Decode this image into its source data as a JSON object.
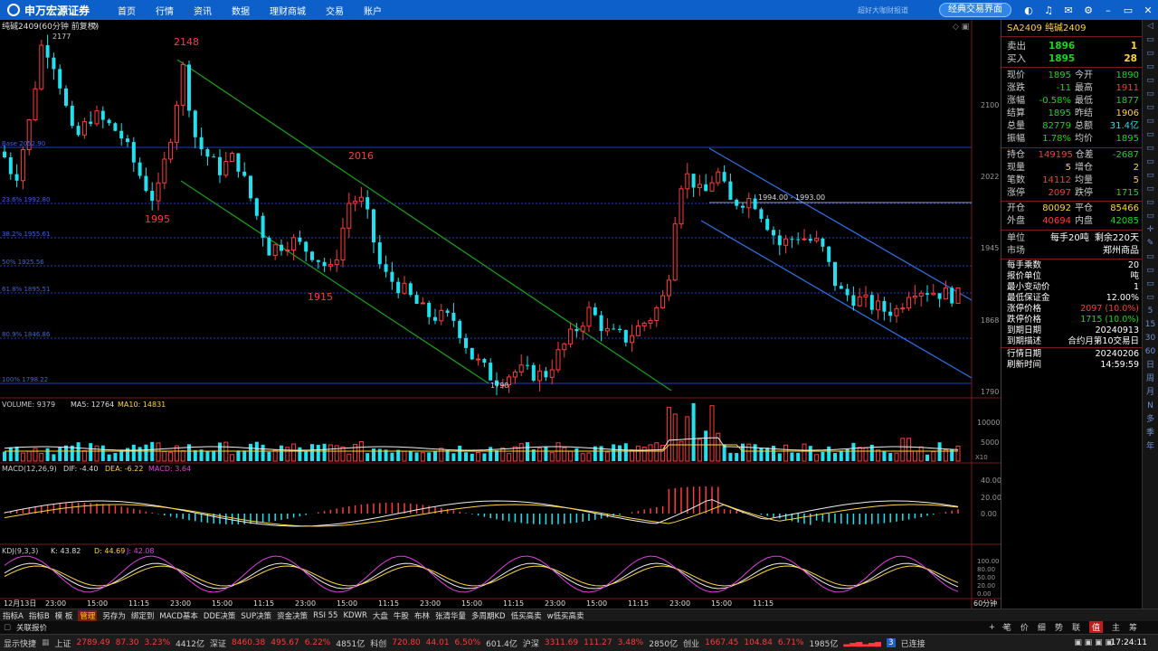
{
  "topbar": {
    "brand": "申万宏源证券",
    "nav": [
      "首页",
      "行情",
      "资讯",
      "数据",
      "理财商城",
      "交易",
      "账户"
    ],
    "slogan": "超好大咖财报道",
    "classic": "经典交易界面",
    "time_top": ""
  },
  "chart": {
    "title": "纯碱2409(60分钟 前复权)",
    "y_labels": [
      "2100",
      "2022",
      "1945",
      "1868",
      "1790"
    ],
    "high_label": "2177",
    "low_label": "1798",
    "annotations": [
      {
        "t": "2148"
      },
      {
        "t": "1995"
      },
      {
        "t": "2016"
      },
      {
        "t": "1915"
      }
    ],
    "fib": [
      "Base 2052.90",
      "23.6% 1992.80",
      "38.2% 1955.61",
      "50% 1925.56",
      "61.8% 1895.51",
      "80.9% 1846.86",
      "100% 1798.22"
    ],
    "box_label": "1994.00 - 1993.00",
    "volume": {
      "label": "VOLUME: 9379",
      "ma5": "MA5: 12764",
      "ma10": "MA10: 14831",
      "y": [
        "10000",
        "5000",
        "X10"
      ]
    },
    "macd": {
      "label": "MACD(12,26,9)",
      "dif": "DIF: -4.40",
      "dea": "DEA: -6.22",
      "macd": "MACD: 3.64",
      "y": [
        "40.00",
        "20.00",
        "0.00"
      ]
    },
    "kdj": {
      "label": "KDJ(9,3,3)",
      "k": "K: 43.82",
      "d": "D: 44.69",
      "j": "J: 42.08",
      "y": [
        "100.00",
        "80.00",
        "50.00",
        "20.00",
        "0.00"
      ]
    },
    "x_labels": [
      "12月13日",
      "23:00",
      "15:00",
      "11:15",
      "23:00",
      "15:00",
      "11:15",
      "23:00",
      "15:00",
      "11:15",
      "23:00",
      "15:00",
      "11:15",
      "23:00",
      "15:00",
      "11:15",
      "23:00",
      "15:00",
      "11:15"
    ],
    "period": "60分钟",
    "colors": {
      "up": "#ff3b3b",
      "down": "#22e0ee",
      "green_channel": "#1a9a1a",
      "blue_channel": "#2b6fe0",
      "fib": "#1a3fbf"
    }
  },
  "quote": {
    "code": "SA2409 纯碱2409",
    "sell": {
      "label": "卖出",
      "price": "1896",
      "vol": "1"
    },
    "buy": {
      "label": "买入",
      "price": "1895",
      "vol": "28"
    },
    "rows1": [
      [
        "现价",
        "1895",
        "今开",
        "1890"
      ],
      [
        "涨跌",
        "-11",
        "最高",
        "1911"
      ],
      [
        "涨幅",
        "-0.58%",
        "最低",
        "1877"
      ],
      [
        "结算",
        "1895",
        "昨结",
        "1906"
      ],
      [
        "总量",
        "82779",
        "总额",
        "31.4亿"
      ],
      [
        "振幅",
        "1.78%",
        "均价",
        "1895"
      ]
    ],
    "rows2": [
      [
        "持仓",
        "149195",
        "仓差",
        "-2687"
      ],
      [
        "现量",
        "5",
        "增仓",
        "2"
      ],
      [
        "笔数",
        "14112",
        "均量",
        "5"
      ],
      [
        "涨停",
        "2097",
        "跌停",
        "1715"
      ]
    ],
    "rows3": [
      [
        "开仓",
        "80092",
        "平仓",
        "85466"
      ],
      [
        "外盘",
        "40694",
        "内盘",
        "42085"
      ]
    ],
    "unit": {
      "l": "单位",
      "v1": "每手20吨",
      "v2": "剩余220天"
    },
    "market": {
      "l": "市场",
      "v": "郑州商品"
    },
    "info": [
      [
        "每手乘数",
        "20"
      ],
      [
        "报价单位",
        "吨"
      ],
      [
        "最小变动价",
        "1"
      ],
      [
        "最低保证金",
        "12.00%"
      ],
      [
        "涨停价格",
        "2097 (10.0%)"
      ],
      [
        "跌停价格",
        "1715 (10.0%)"
      ],
      [
        "到期日期",
        "20240913"
      ],
      [
        "到期描述",
        "合约月第10交易日"
      ]
    ],
    "info2": [
      [
        "行情日期",
        "20240206"
      ],
      [
        "刷新时间",
        "14:59:59"
      ]
    ]
  },
  "tabs": [
    "指标A",
    "指标B",
    "模 板",
    "管理",
    "另存为",
    "绑定到",
    "MACD基本",
    "DDE决策",
    "SUP决策",
    "资金决策",
    "RSI 55",
    "KDWR",
    "大盘",
    "牛股",
    "布林",
    "张清华量",
    "多周期KD",
    "低买高卖",
    "w低买高卖"
  ],
  "tabs2": [
    "关联报价"
  ],
  "rtabs": [
    "笔",
    "价",
    "细",
    "势",
    "联",
    "值",
    "主",
    "筹"
  ],
  "status": {
    "quick": "显示快捷",
    "sh": "上证",
    "sh_v": "2789.49",
    "sh_c": "87.30",
    "sh_p": "3.23%",
    "sh_a": "4412亿",
    "sz": "深证",
    "sz_v": "8460.38",
    "sz_c": "495.67",
    "sz_p": "6.22%",
    "sz_a": "4851亿",
    "kc": "科创",
    "kc_v": "720.80",
    "kc_c": "44.01",
    "kc_p": "6.50%",
    "kc_a": "601.4亿",
    "hs": "沪深",
    "hs_v": "3311.69",
    "hs_c": "111.27",
    "hs_p": "3.48%",
    "hs_a": "2850亿",
    "cy": "创业",
    "cy_v": "1667.45",
    "cy_c": "104.84",
    "cy_p": "6.71%",
    "cy_a": "1985亿",
    "conn": "已连接",
    "time": "17:24:11"
  },
  "right_tools": [
    "◁",
    "▭",
    "▭",
    "▭",
    "▭",
    "▭",
    "▭",
    "▭",
    "▭",
    "▭",
    "▭",
    "▭",
    "▭",
    "▭",
    "▭",
    "✛",
    "✎",
    "▭",
    "▭",
    "▭",
    "▭",
    "5",
    "15",
    "30",
    "60",
    "日",
    "周",
    "月",
    "N",
    "多",
    "季",
    "年"
  ]
}
